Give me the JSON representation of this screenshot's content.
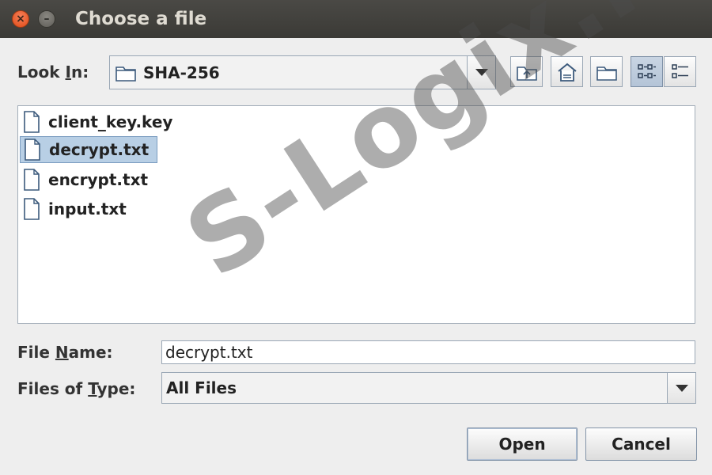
{
  "window": {
    "title": "Choose a file",
    "close_glyph": "×",
    "minimize_glyph": "–"
  },
  "look_in": {
    "label_pre": "Look ",
    "label_mnemonic": "I",
    "label_post": "n:",
    "value": "SHA-256",
    "icon": "folder-icon"
  },
  "toolbar": {
    "buttons": [
      "up-one-level-icon",
      "home-icon",
      "new-folder-icon",
      "list-view-icon",
      "details-view-icon"
    ],
    "active": "list-view-icon"
  },
  "files": [
    {
      "name": "client_key.key",
      "selected": false
    },
    {
      "name": "decrypt.txt",
      "selected": true
    },
    {
      "name": "encrypt.txt",
      "selected": false
    },
    {
      "name": "input.txt",
      "selected": false
    }
  ],
  "file_name": {
    "label_pre": "File ",
    "label_mnemonic": "N",
    "label_post": "ame:",
    "value": "decrypt.txt"
  },
  "file_type": {
    "label_pre": "Files of ",
    "label_mnemonic": "T",
    "label_post": "ype:",
    "value": "All Files"
  },
  "buttons": {
    "open": "Open",
    "cancel": "Cancel"
  },
  "watermark": "S-Logix.in",
  "colors": {
    "selection": "#b8cfe5",
    "titlebar": "#3f3e3a",
    "close_button": "#e9551d"
  }
}
